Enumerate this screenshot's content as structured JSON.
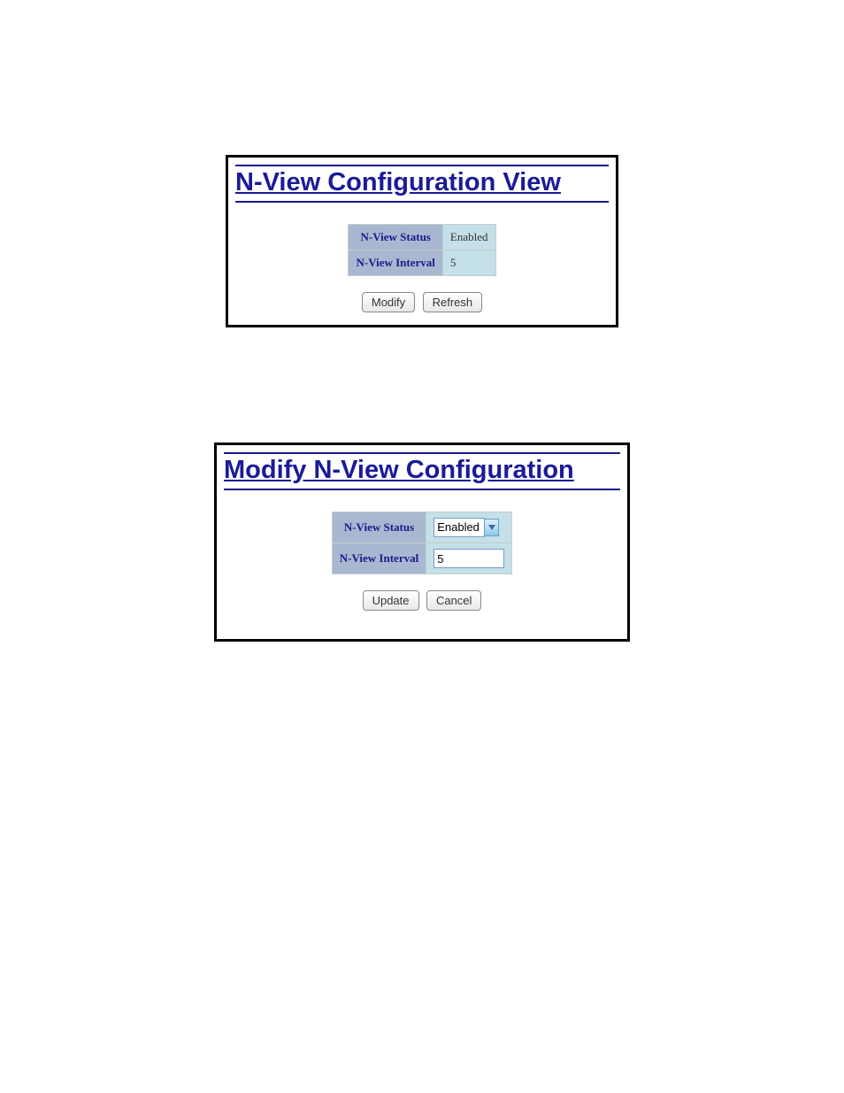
{
  "panel1": {
    "title": "N-View Configuration View",
    "rows": {
      "status_label": "N-View Status",
      "status_value": "Enabled",
      "interval_label": "N-View Interval",
      "interval_value": "5"
    },
    "buttons": {
      "modify": "Modify",
      "refresh": "Refresh"
    }
  },
  "panel2": {
    "title": "Modify N-View Configuration",
    "rows": {
      "status_label": "N-View Status",
      "status_selected": "Enabled",
      "interval_label": "N-View Interval",
      "interval_value": "5"
    },
    "buttons": {
      "update": "Update",
      "cancel": "Cancel"
    }
  }
}
